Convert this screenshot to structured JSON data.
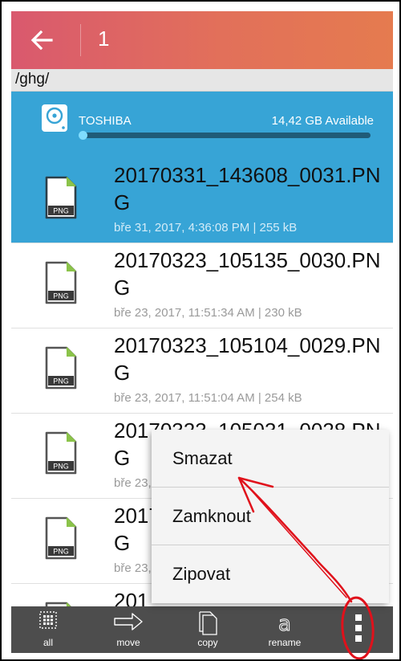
{
  "appbar": {
    "title": "1",
    "back_icon": "arrow-left-icon"
  },
  "path": {
    "text": "/ghg/"
  },
  "storage": {
    "name": "TOSHIBA",
    "available": "14,42 GB Available",
    "used_fraction": 0.02,
    "icon": "disk-icon"
  },
  "files": [
    {
      "name": "20170331_143608_0031.PNG",
      "meta": "bře 31, 2017, 4:36:08 PM | 255 kB",
      "selected": true,
      "icon_label": "PNG"
    },
    {
      "name": "20170323_105135_0030.PNG",
      "meta": "bře 23, 2017, 11:51:34 AM | 230 kB",
      "selected": false,
      "icon_label": "PNG"
    },
    {
      "name": "20170323_105104_0029.PNG",
      "meta": "bře 23, 2017, 11:51:04 AM | 254 kB",
      "selected": false,
      "icon_label": "PNG"
    },
    {
      "name": "20170323_105031_0028.PNG",
      "meta": "bře 23, 2017",
      "selected": false,
      "icon_label": "PNG"
    },
    {
      "name": "20170323_105001_0027.PNG",
      "meta": "bře 23, 2017",
      "selected": false,
      "icon_label": "PNG"
    },
    {
      "name": "201",
      "meta": "",
      "selected": false,
      "icon_label": "PNG"
    }
  ],
  "toolbar": {
    "all_label": "all",
    "move_label": "move",
    "copy_label": "copy",
    "rename_label": "rename"
  },
  "menu": {
    "items": [
      "Smazat",
      "Zamknout",
      "Zipovat"
    ]
  },
  "colors": {
    "appbar_start": "#d9596e",
    "appbar_end": "#e57b4f",
    "selection": "#37a4d6",
    "toolbar": "#4d4d4d",
    "annotation": "#e0111b"
  }
}
